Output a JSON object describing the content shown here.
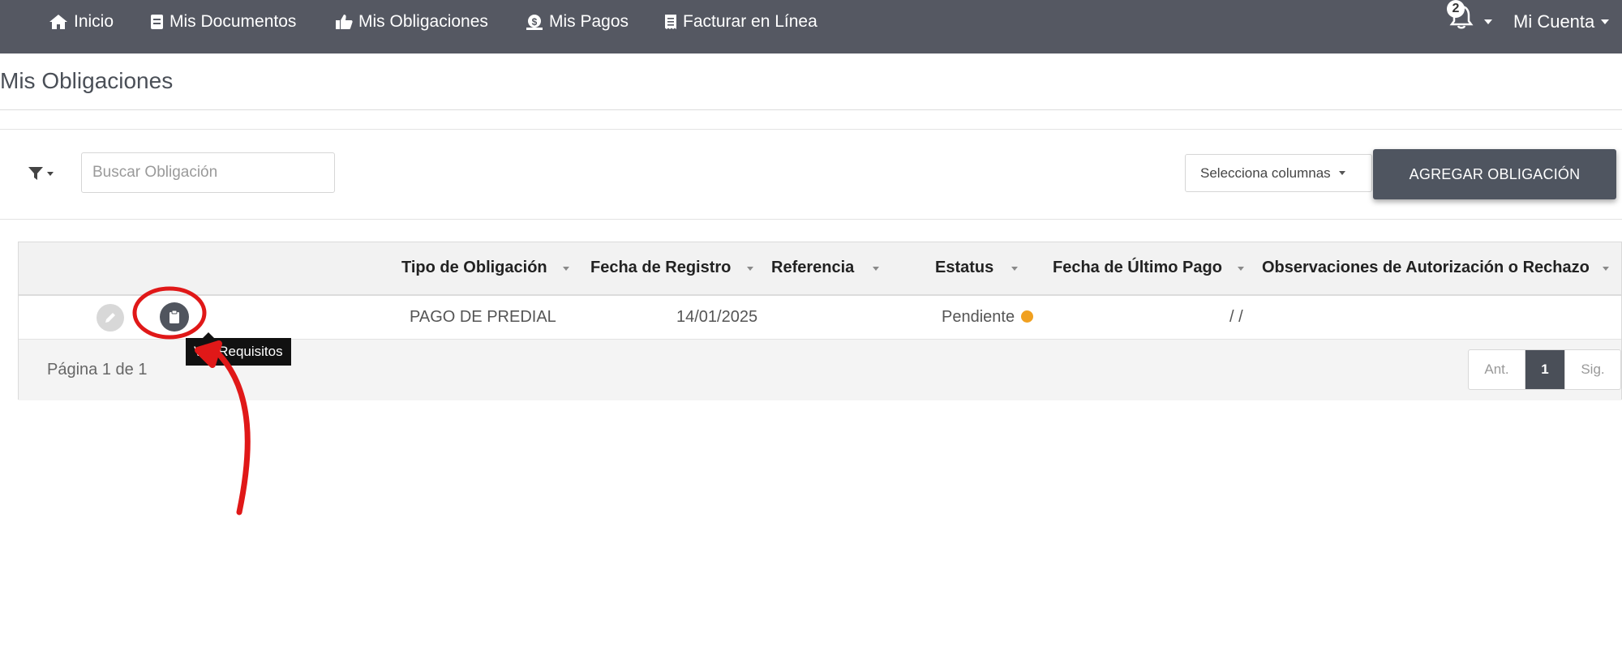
{
  "navbar": {
    "items": [
      {
        "label": "Inicio",
        "icon": "home-icon"
      },
      {
        "label": "Mis Documentos",
        "icon": "document-icon"
      },
      {
        "label": "Mis Obligaciones",
        "icon": "thumbs-up-icon"
      },
      {
        "label": "Mis Pagos",
        "icon": "money-icon"
      },
      {
        "label": "Facturar en Línea",
        "icon": "receipt-icon"
      }
    ],
    "notifications_count": "2",
    "account_label": "Mi Cuenta"
  },
  "page": {
    "title": "Mis Obligaciones"
  },
  "toolbar": {
    "search_placeholder": "Buscar Obligación",
    "columns_select_label": "Selecciona columnas",
    "add_button_label": "AGREGAR OBLIGACIÓN"
  },
  "table": {
    "columns": [
      "Tipo de Obligación",
      "Fecha de Registro",
      "Referencia",
      "Estatus",
      "Fecha de Último Pago",
      "Observaciones de Autorización o Rechazo"
    ],
    "rows": [
      {
        "tipo": "PAGO DE PREDIAL",
        "fecha_registro": "14/01/2025",
        "referencia": "",
        "estatus": "Pendiente",
        "fecha_ultimo_pago": "/ /",
        "observaciones": ""
      }
    ],
    "status_color": "#f0a020"
  },
  "pagination": {
    "info": "Página 1 de 1",
    "prev": "Ant.",
    "current": "1",
    "next": "Sig."
  },
  "tooltip": {
    "text": "Ver Requisitos"
  },
  "colors": {
    "navbar": "#555862",
    "primary_button": "#4f5560",
    "annotation": "#e01818"
  }
}
